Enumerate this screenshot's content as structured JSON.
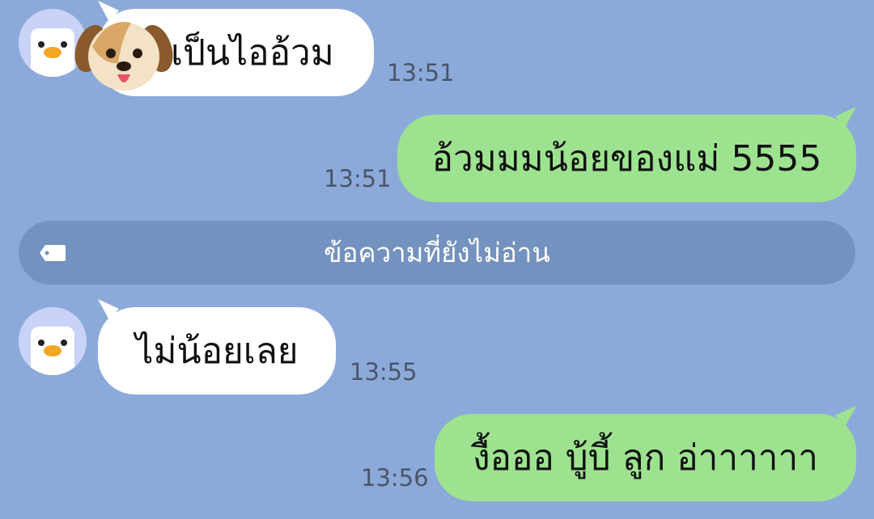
{
  "messages": [
    {
      "sender": "penguin-contact",
      "direction": "incoming",
      "text": "เป็นไออ้วม",
      "time": "13:51",
      "sticker": "puppy-face-icon"
    },
    {
      "sender": "me",
      "direction": "outgoing",
      "text": "อ้วมมมน้อยของแม่ 5555",
      "time": "13:51"
    },
    {
      "sender": "penguin-contact",
      "direction": "incoming",
      "text": "ไม่น้อยเลย",
      "time": "13:55"
    },
    {
      "sender": "me",
      "direction": "outgoing",
      "text": "งื้อออ บู้บี้ ลูก อ่าาาาาา",
      "time": "13:56"
    }
  ],
  "unread_divider": {
    "label": "ข้อความที่ยังไม่อ่าน",
    "icon": "tag-icon"
  },
  "colors": {
    "background": "#8caad9",
    "incoming_bubble": "#ffffff",
    "outgoing_bubble": "#9de38f",
    "divider": "#7392bf",
    "avatar_bg": "#c9d2f7"
  }
}
